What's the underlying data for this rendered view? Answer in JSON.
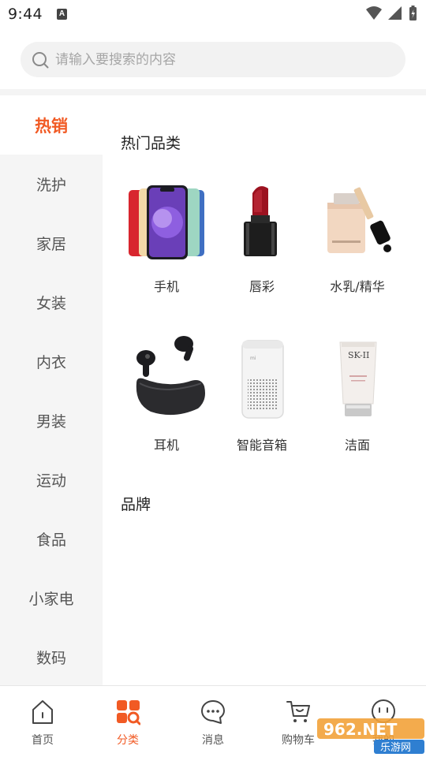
{
  "status_bar": {
    "time": "9:44",
    "notification_icon_letter": "A",
    "icons": [
      "wifi-icon",
      "signal-icon",
      "battery-icon"
    ]
  },
  "search": {
    "placeholder": "请输入要搜索的内容",
    "value": ""
  },
  "sidebar": {
    "items": [
      {
        "label": "热销",
        "active": true
      },
      {
        "label": "洗护",
        "active": false
      },
      {
        "label": "家居",
        "active": false
      },
      {
        "label": "女装",
        "active": false
      },
      {
        "label": "内衣",
        "active": false
      },
      {
        "label": "男装",
        "active": false
      },
      {
        "label": "运动",
        "active": false
      },
      {
        "label": "食品",
        "active": false
      },
      {
        "label": "小家电",
        "active": false
      },
      {
        "label": "数码",
        "active": false
      }
    ]
  },
  "content": {
    "hot_section_title": "热门品类",
    "brand_section_title": "品牌",
    "categories": [
      {
        "label": "手机",
        "icon": "phone-image"
      },
      {
        "label": "唇彩",
        "icon": "lipstick-image"
      },
      {
        "label": "水乳/精华",
        "icon": "serum-image"
      },
      {
        "label": "耳机",
        "icon": "earbuds-image"
      },
      {
        "label": "智能音箱",
        "icon": "smart-speaker-image"
      },
      {
        "label": "洁面",
        "icon": "cleanser-image"
      }
    ]
  },
  "bottom_nav": {
    "items": [
      {
        "label": "首页",
        "icon": "home-icon",
        "active": false
      },
      {
        "label": "分类",
        "icon": "category-icon",
        "active": true
      },
      {
        "label": "消息",
        "icon": "message-icon",
        "active": false
      },
      {
        "label": "购物车",
        "icon": "cart-icon",
        "active": false
      },
      {
        "label": "我的",
        "icon": "profile-icon",
        "active": false
      }
    ]
  },
  "watermark": {
    "top_text": "962.NET",
    "bottom_text": "乐游网"
  },
  "colors": {
    "accent": "#f15a24",
    "sidebar_bg": "#f5f5f5",
    "search_bg": "#f2f2f2"
  }
}
